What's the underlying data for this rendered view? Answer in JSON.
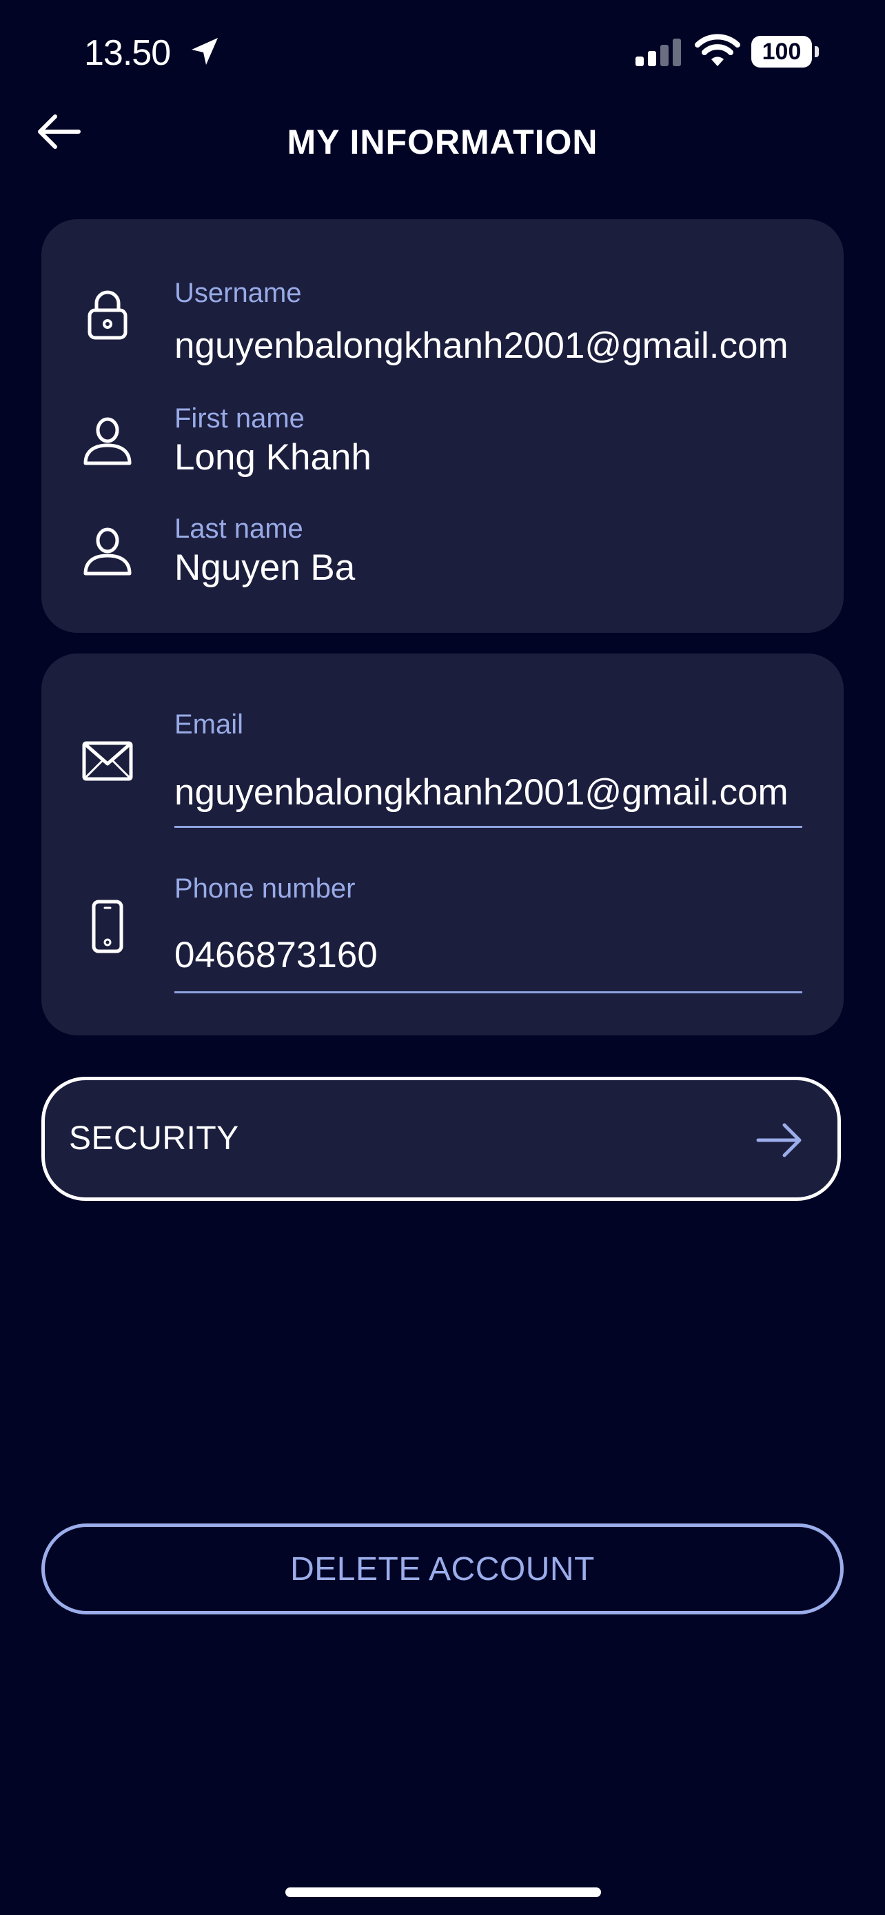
{
  "status_bar": {
    "time": "13.50",
    "battery": "100"
  },
  "header": {
    "title": "MY INFORMATION"
  },
  "profile_card": {
    "username_label": "Username",
    "username_value": "nguyenbalongkhanh2001@gmail.com",
    "first_name_label": "First name",
    "first_name_value": "Long Khanh",
    "last_name_label": "Last name",
    "last_name_value": "Nguyen Ba"
  },
  "contact_card": {
    "email_label": "Email",
    "email_value": "nguyenbalongkhanh2001@gmail.com",
    "phone_label": "Phone number",
    "phone_value": "0466873160"
  },
  "security_button": {
    "label": "SECURITY"
  },
  "delete_button": {
    "label": "DELETE ACCOUNT"
  },
  "icons": {
    "back": "arrow-left-icon",
    "location": "location-arrow-icon",
    "signal": "cellular-signal-icon",
    "wifi": "wifi-icon",
    "username": "lock-icon",
    "first_name": "person-icon",
    "last_name": "person-icon",
    "email": "envelope-icon",
    "phone": "mobile-phone-icon",
    "security_arrow": "arrow-right-icon"
  },
  "colors": {
    "background": "#020426",
    "card": "#1c1e3e",
    "label": "#98abe6",
    "accent": "#9badea",
    "text": "#ffffff"
  }
}
